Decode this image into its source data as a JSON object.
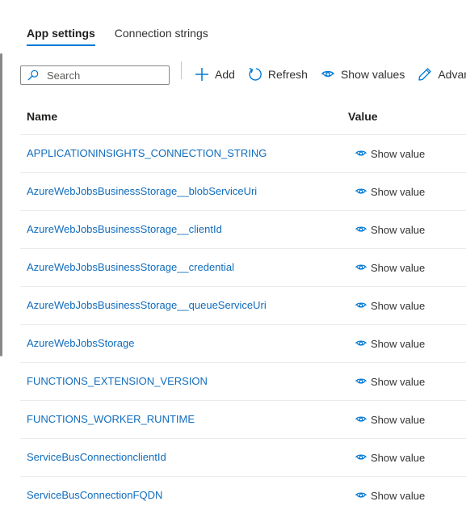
{
  "tabs": [
    {
      "label": "App settings",
      "active": true
    },
    {
      "label": "Connection strings",
      "active": false
    }
  ],
  "search": {
    "placeholder": "Search",
    "value": ""
  },
  "toolbar": {
    "add_label": "Add",
    "refresh_label": "Refresh",
    "show_values_label": "Show values",
    "advanced_label": "Advanced"
  },
  "grid": {
    "columns": {
      "name": "Name",
      "value": "Value"
    },
    "rows": [
      {
        "name": "APPLICATIONINSIGHTS_CONNECTION_STRING",
        "value": "Show value"
      },
      {
        "name": "AzureWebJobsBusinessStorage__blobServiceUri",
        "value": "Show value"
      },
      {
        "name": "AzureWebJobsBusinessStorage__clientId",
        "value": "Show value"
      },
      {
        "name": "AzureWebJobsBusinessStorage__credential",
        "value": "Show value"
      },
      {
        "name": "AzureWebJobsBusinessStorage__queueServiceUri",
        "value": "Show value"
      },
      {
        "name": "AzureWebJobsStorage",
        "value": "Show value"
      },
      {
        "name": "FUNCTIONS_EXTENSION_VERSION",
        "value": "Show value"
      },
      {
        "name": "FUNCTIONS_WORKER_RUNTIME",
        "value": "Show value"
      },
      {
        "name": "ServiceBusConnectionclientId",
        "value": "Show value"
      },
      {
        "name": "ServiceBusConnectionFQDN",
        "value": "Show value"
      }
    ]
  },
  "colors": {
    "accent": "#0078d4",
    "link": "#0f6cbd",
    "text": "#323130",
    "border": "#edebe9"
  },
  "icons": {
    "search": "search-icon",
    "add": "plus-icon",
    "refresh": "refresh-icon",
    "show_values": "eye-icon",
    "advanced": "pencil-icon"
  }
}
